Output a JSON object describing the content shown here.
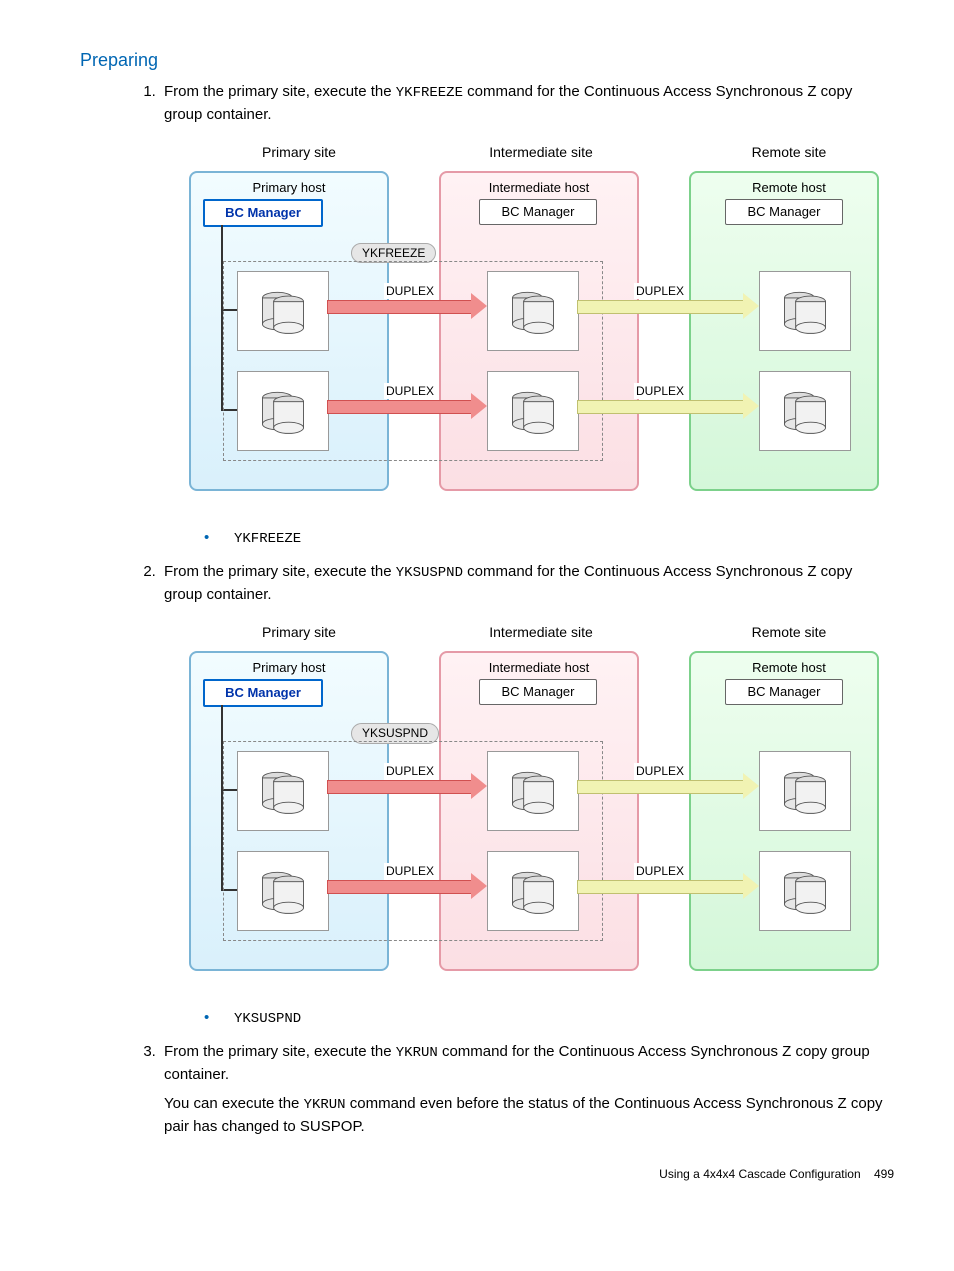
{
  "heading": "Preparing",
  "steps": [
    {
      "pre": "From the primary site, execute the ",
      "cmd": "YKFREEZE",
      "post": " command for the Continuous Access Synchronous Z copy group container.",
      "bullet_cmd": "YKFREEZE",
      "diagram": {
        "primary_site": "Primary site",
        "intermediate_site": "Intermediate site",
        "remote_site": "Remote site",
        "primary_host": "Primary host",
        "intermediate_host": "Intermediate host",
        "remote_host": "Remote host",
        "bcm": "BC Manager",
        "chip": "YKFREEZE",
        "state_pi": "DUPLEX",
        "state_ir": "DUPLEX"
      }
    },
    {
      "pre": "From the primary site, execute the ",
      "cmd": "YKSUSPND",
      "post": " command for the Continuous Access Synchronous Z copy group container.",
      "bullet_cmd": "YKSUSPND",
      "diagram": {
        "primary_site": "Primary site",
        "intermediate_site": "Intermediate site",
        "remote_site": "Remote site",
        "primary_host": "Primary host",
        "intermediate_host": "Intermediate host",
        "remote_host": "Remote host",
        "bcm": "BC Manager",
        "chip": "YKSUSPND",
        "state_pi": "DUPLEX",
        "state_ir": "DUPLEX"
      }
    },
    {
      "pre": "From the primary site, execute the ",
      "cmd": "YKRUN",
      "post": " command for the Continuous Access Synchronous Z copy group container.",
      "extra_pre": "You can execute the ",
      "extra_cmd": "YKRUN",
      "extra_post": " command even before the status of the Continuous Access Synchronous Z copy pair has changed to SUSPOP."
    }
  ],
  "footer_text": "Using a 4x4x4 Cascade Configuration",
  "page_number": "499"
}
